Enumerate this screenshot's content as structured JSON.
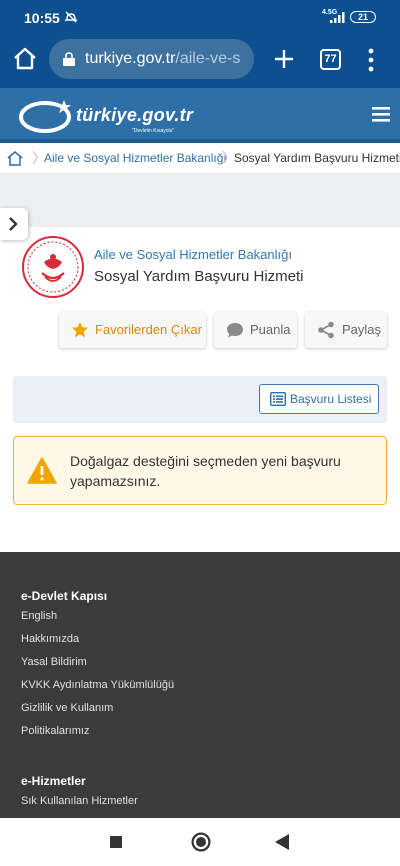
{
  "status_bar": {
    "time": "10:55",
    "network": "4.5G",
    "battery": "21"
  },
  "browser": {
    "url_domain": "turkiye.gov.tr",
    "url_path": "/aile-ve-s",
    "tab_count": "77"
  },
  "site": {
    "logo_text": "türkiye.gov.tr",
    "logo_sub": "\"Devletin Kısayolu\""
  },
  "breadcrumb": {
    "items": [
      "Aile ve Sosyal Hizmetler Bakanlığı",
      "Sosyal Yardım Başvuru Hizmeti"
    ]
  },
  "service": {
    "ministry": "Aile ve Sosyal Hizmetler Bakanlığı",
    "title": "Sosyal Yardım Başvuru Hizmeti"
  },
  "actions": {
    "favorite": "Favorilerden Çıkar",
    "rate": "Puanla",
    "share": "Paylaş"
  },
  "list_button": "Başvuru Listesi",
  "warning": "Doğalgaz desteğini seçmeden yeni başvuru yapamazsınız.",
  "footer": {
    "sections": [
      {
        "title": "e-Devlet Kapısı",
        "links": [
          "English",
          "Hakkımızda",
          "Yasal Bildirim",
          "KVKK Aydınlatma Yükümlülüğü",
          "Gizlilik ve Kullanım",
          "Politikalarımız"
        ]
      },
      {
        "title": "e-Hizmetler",
        "links": [
          "Sık Kullanılan Hizmetler"
        ]
      }
    ]
  },
  "colors": {
    "browser_bar": "#0e4f8f",
    "header": "#2f6fa8",
    "link": "#2f78b5",
    "favorite": "#d88a00",
    "warning_border": "#f1b43a",
    "footer": "#3b3b3b"
  },
  "icons": [
    "home-icon",
    "lock-icon",
    "plus-icon",
    "menu-dots-icon",
    "hamburger-icon",
    "star-icon",
    "comment-icon",
    "share-icon",
    "list-icon",
    "warning-icon",
    "chevron-right-icon"
  ]
}
